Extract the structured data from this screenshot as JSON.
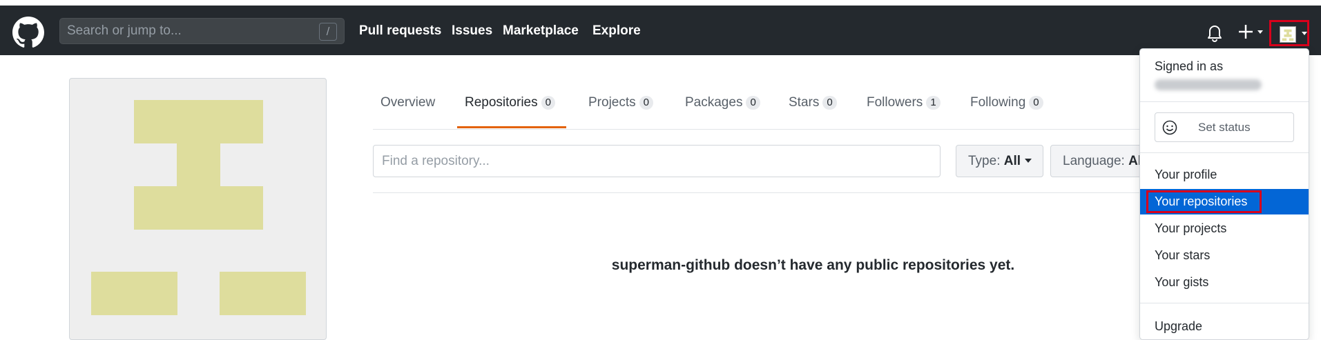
{
  "header": {
    "search_placeholder": "Search or jump to...",
    "search_shortcut": "/",
    "nav": [
      "Pull requests",
      "Issues",
      "Marketplace",
      "Explore"
    ],
    "icons": [
      "github-mark-icon",
      "bell-icon",
      "plus-icon",
      "avatar"
    ]
  },
  "tabs": [
    {
      "label": "Overview",
      "count": null
    },
    {
      "label": "Repositories",
      "count": "0"
    },
    {
      "label": "Projects",
      "count": "0"
    },
    {
      "label": "Packages",
      "count": "0"
    },
    {
      "label": "Stars",
      "count": "0"
    },
    {
      "label": "Followers",
      "count": "1"
    },
    {
      "label": "Following",
      "count": "0"
    }
  ],
  "selected_tab": "Repositories",
  "filters": {
    "find_placeholder": "Find a repository...",
    "type_label": "Type:",
    "type_value": "All",
    "language_label": "Language:",
    "language_value": "All"
  },
  "empty_message": "superman-github doesn’t have any public repositories yet.",
  "dropdown": {
    "signed_in_as": "Signed in as",
    "set_status": "Set status",
    "items": [
      "Your profile",
      "Your repositories",
      "Your projects",
      "Your stars",
      "Your gists"
    ],
    "active_item": "Your repositories",
    "upgrade": "Upgrade"
  },
  "colors": {
    "header_bg": "#24292e",
    "tab_accent": "#e36209",
    "active_menu": "#0366d6",
    "annotation_red": "#d9001b",
    "identicon": "#dedd9d"
  }
}
